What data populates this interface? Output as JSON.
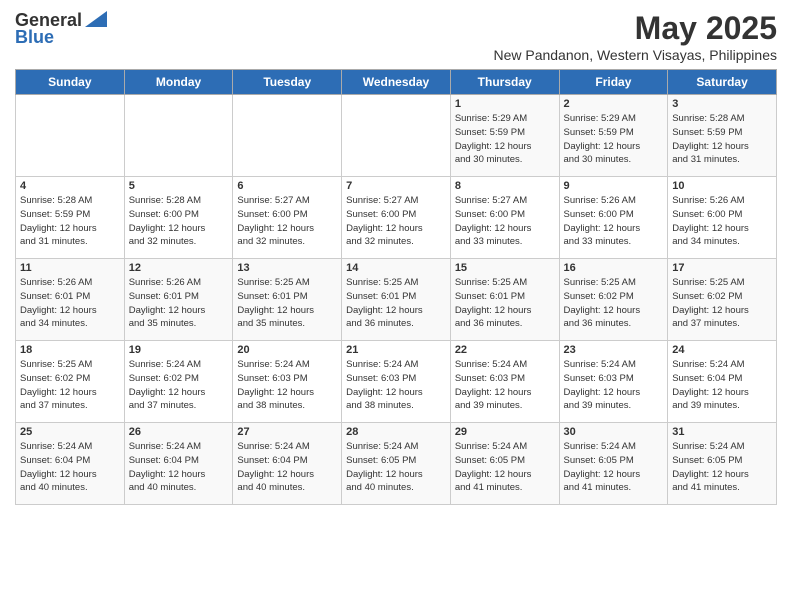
{
  "logo": {
    "general": "General",
    "blue": "Blue"
  },
  "title": "May 2025",
  "subtitle": "New Pandanon, Western Visayas, Philippines",
  "days_header": [
    "Sunday",
    "Monday",
    "Tuesday",
    "Wednesday",
    "Thursday",
    "Friday",
    "Saturday"
  ],
  "weeks": [
    [
      {
        "day": "",
        "info": ""
      },
      {
        "day": "",
        "info": ""
      },
      {
        "day": "",
        "info": ""
      },
      {
        "day": "",
        "info": ""
      },
      {
        "day": "1",
        "info": "Sunrise: 5:29 AM\nSunset: 5:59 PM\nDaylight: 12 hours\nand 30 minutes."
      },
      {
        "day": "2",
        "info": "Sunrise: 5:29 AM\nSunset: 5:59 PM\nDaylight: 12 hours\nand 30 minutes."
      },
      {
        "day": "3",
        "info": "Sunrise: 5:28 AM\nSunset: 5:59 PM\nDaylight: 12 hours\nand 31 minutes."
      }
    ],
    [
      {
        "day": "4",
        "info": "Sunrise: 5:28 AM\nSunset: 5:59 PM\nDaylight: 12 hours\nand 31 minutes."
      },
      {
        "day": "5",
        "info": "Sunrise: 5:28 AM\nSunset: 6:00 PM\nDaylight: 12 hours\nand 32 minutes."
      },
      {
        "day": "6",
        "info": "Sunrise: 5:27 AM\nSunset: 6:00 PM\nDaylight: 12 hours\nand 32 minutes."
      },
      {
        "day": "7",
        "info": "Sunrise: 5:27 AM\nSunset: 6:00 PM\nDaylight: 12 hours\nand 32 minutes."
      },
      {
        "day": "8",
        "info": "Sunrise: 5:27 AM\nSunset: 6:00 PM\nDaylight: 12 hours\nand 33 minutes."
      },
      {
        "day": "9",
        "info": "Sunrise: 5:26 AM\nSunset: 6:00 PM\nDaylight: 12 hours\nand 33 minutes."
      },
      {
        "day": "10",
        "info": "Sunrise: 5:26 AM\nSunset: 6:00 PM\nDaylight: 12 hours\nand 34 minutes."
      }
    ],
    [
      {
        "day": "11",
        "info": "Sunrise: 5:26 AM\nSunset: 6:01 PM\nDaylight: 12 hours\nand 34 minutes."
      },
      {
        "day": "12",
        "info": "Sunrise: 5:26 AM\nSunset: 6:01 PM\nDaylight: 12 hours\nand 35 minutes."
      },
      {
        "day": "13",
        "info": "Sunrise: 5:25 AM\nSunset: 6:01 PM\nDaylight: 12 hours\nand 35 minutes."
      },
      {
        "day": "14",
        "info": "Sunrise: 5:25 AM\nSunset: 6:01 PM\nDaylight: 12 hours\nand 36 minutes."
      },
      {
        "day": "15",
        "info": "Sunrise: 5:25 AM\nSunset: 6:01 PM\nDaylight: 12 hours\nand 36 minutes."
      },
      {
        "day": "16",
        "info": "Sunrise: 5:25 AM\nSunset: 6:02 PM\nDaylight: 12 hours\nand 36 minutes."
      },
      {
        "day": "17",
        "info": "Sunrise: 5:25 AM\nSunset: 6:02 PM\nDaylight: 12 hours\nand 37 minutes."
      }
    ],
    [
      {
        "day": "18",
        "info": "Sunrise: 5:25 AM\nSunset: 6:02 PM\nDaylight: 12 hours\nand 37 minutes."
      },
      {
        "day": "19",
        "info": "Sunrise: 5:24 AM\nSunset: 6:02 PM\nDaylight: 12 hours\nand 37 minutes."
      },
      {
        "day": "20",
        "info": "Sunrise: 5:24 AM\nSunset: 6:03 PM\nDaylight: 12 hours\nand 38 minutes."
      },
      {
        "day": "21",
        "info": "Sunrise: 5:24 AM\nSunset: 6:03 PM\nDaylight: 12 hours\nand 38 minutes."
      },
      {
        "day": "22",
        "info": "Sunrise: 5:24 AM\nSunset: 6:03 PM\nDaylight: 12 hours\nand 39 minutes."
      },
      {
        "day": "23",
        "info": "Sunrise: 5:24 AM\nSunset: 6:03 PM\nDaylight: 12 hours\nand 39 minutes."
      },
      {
        "day": "24",
        "info": "Sunrise: 5:24 AM\nSunset: 6:04 PM\nDaylight: 12 hours\nand 39 minutes."
      }
    ],
    [
      {
        "day": "25",
        "info": "Sunrise: 5:24 AM\nSunset: 6:04 PM\nDaylight: 12 hours\nand 40 minutes."
      },
      {
        "day": "26",
        "info": "Sunrise: 5:24 AM\nSunset: 6:04 PM\nDaylight: 12 hours\nand 40 minutes."
      },
      {
        "day": "27",
        "info": "Sunrise: 5:24 AM\nSunset: 6:04 PM\nDaylight: 12 hours\nand 40 minutes."
      },
      {
        "day": "28",
        "info": "Sunrise: 5:24 AM\nSunset: 6:05 PM\nDaylight: 12 hours\nand 40 minutes."
      },
      {
        "day": "29",
        "info": "Sunrise: 5:24 AM\nSunset: 6:05 PM\nDaylight: 12 hours\nand 41 minutes."
      },
      {
        "day": "30",
        "info": "Sunrise: 5:24 AM\nSunset: 6:05 PM\nDaylight: 12 hours\nand 41 minutes."
      },
      {
        "day": "31",
        "info": "Sunrise: 5:24 AM\nSunset: 6:05 PM\nDaylight: 12 hours\nand 41 minutes."
      }
    ]
  ]
}
